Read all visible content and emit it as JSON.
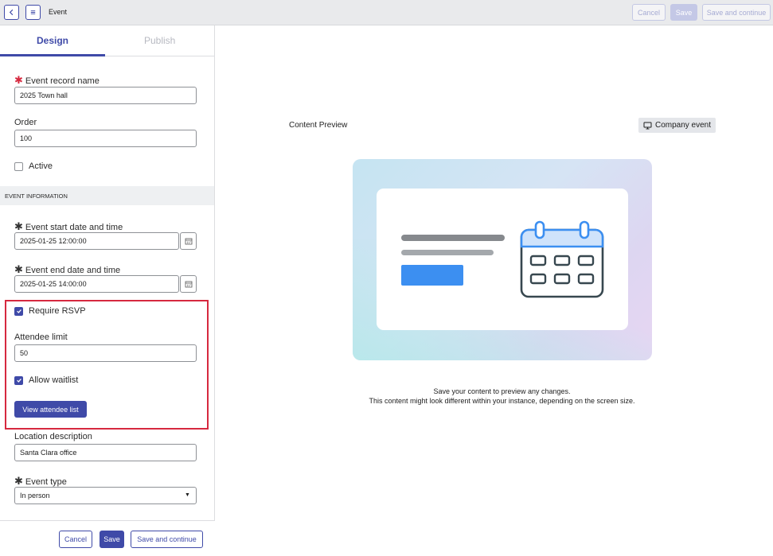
{
  "topbar": {
    "back_icon": "chevron-left-icon",
    "menu_icon": "menu-icon",
    "title": "Event",
    "cancel_label": "Cancel",
    "save_label": "Save",
    "save_continue_label": "Save and continue"
  },
  "tabs": [
    {
      "label": "Design",
      "active": true
    },
    {
      "label": "Publish",
      "active": false
    }
  ],
  "form": {
    "record_name_label": "Event record name",
    "record_name_value": "2025 Town hall",
    "order_label": "Order",
    "order_value": "100",
    "active_label": "Active",
    "active_checked": false,
    "section_header": "EVENT INFORMATION",
    "start_label": "Event start date and time",
    "start_value": "2025-01-25 12:00:00",
    "end_label": "Event end date and time",
    "end_value": "2025-01-25 14:00:00",
    "rsvp_label": "Require RSVP",
    "rsvp_checked": true,
    "attendee_limit_label": "Attendee limit",
    "attendee_limit_value": "50",
    "waitlist_label": "Allow waitlist",
    "waitlist_checked": true,
    "view_attendee_label": "View attendee list",
    "location_label": "Location description",
    "location_value": "Santa Clara office",
    "event_type_label": "Event type",
    "event_type_value": "In person"
  },
  "footer": {
    "cancel_label": "Cancel",
    "save_label": "Save",
    "save_continue_label": "Save and continue"
  },
  "preview": {
    "title": "Content Preview",
    "badge_label": "Company event",
    "badge_icon": "monitor-icon",
    "message_line1": "Save your content to preview any changes.",
    "message_line2": "This content might look different within your instance, depending on the screen size."
  },
  "colors": {
    "accent": "#3f4aa8",
    "required": "#d6293f",
    "highlight_border": "#d6293f",
    "preview_blue": "#3c8ff1"
  }
}
